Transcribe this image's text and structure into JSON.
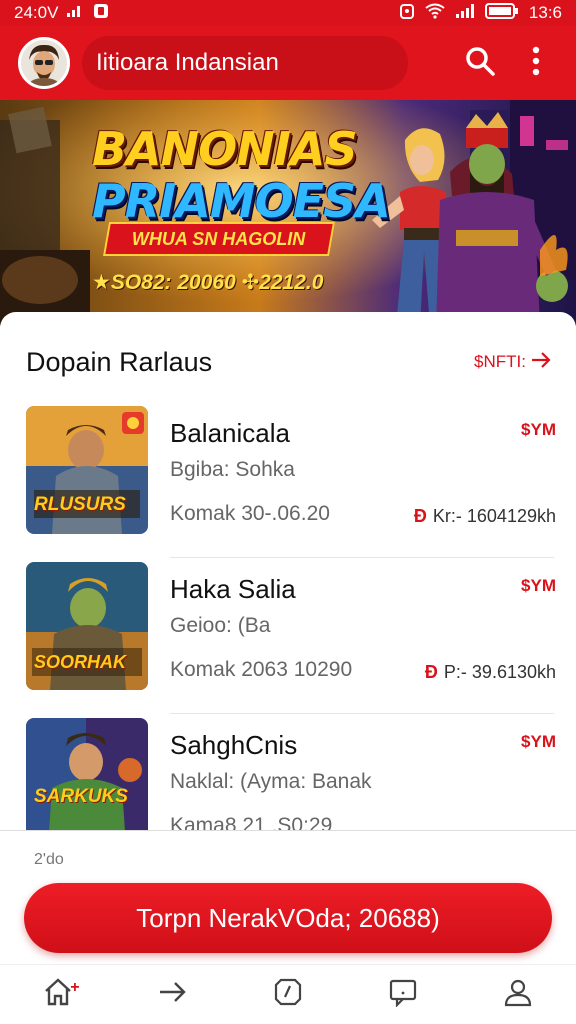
{
  "status_bar": {
    "time": "24:0V",
    "clock_right": "13:6",
    "icons": [
      "signal-icon",
      "notification-icon",
      "alarm-icon",
      "wifi-icon",
      "cellular-icon",
      "battery-icon"
    ]
  },
  "header": {
    "title": "Iitioara Indansian",
    "icons": [
      "search-icon",
      "more-vertical-icon"
    ]
  },
  "banner": {
    "title_line1": "BANONIAS",
    "title_line2": "PRIAMOESA",
    "ribbon": "WHUA SN HAGOLIN",
    "promo": "★SO82: 20060 ✣2212.0"
  },
  "section": {
    "title": "Dopain Rarlaus",
    "see_all": "$NFTI:"
  },
  "games": [
    {
      "name": "Balanicala",
      "subtitle": "Bgiba: Sohka",
      "meta": "Komak 30-.06.20",
      "price": "$YM",
      "amount_mark": "Ɖ",
      "amount": "Kr:- 1604129kh",
      "thumb_title": "RLUSURS"
    },
    {
      "name": "Haka Salia",
      "subtitle": "Geioo: (Ba",
      "meta": "Komak 2063 10290",
      "price": "$YM",
      "amount_mark": "Ɖ",
      "amount": "P:- 39.6130kh",
      "thumb_title": "SOORHAK"
    },
    {
      "name": "SahghCnis",
      "subtitle": "Naklal: (Ayma: Banak",
      "meta": "Kama8 21 .S0:29",
      "price": "$YM",
      "amount_mark": "",
      "amount": "",
      "thumb_title": "SARKUKS"
    }
  ],
  "bottom_sheet": {
    "count": "2'do",
    "cta_label": "Torpn NerakVOda; 20688)"
  },
  "nav": {
    "items": [
      "home-icon",
      "forward-icon",
      "discover-icon",
      "chat-icon",
      "profile-icon"
    ],
    "home_badge": "+"
  },
  "colors": {
    "brand": "#e0141d",
    "brand_dark": "#c90f17",
    "accent_text": "#d9121b"
  }
}
